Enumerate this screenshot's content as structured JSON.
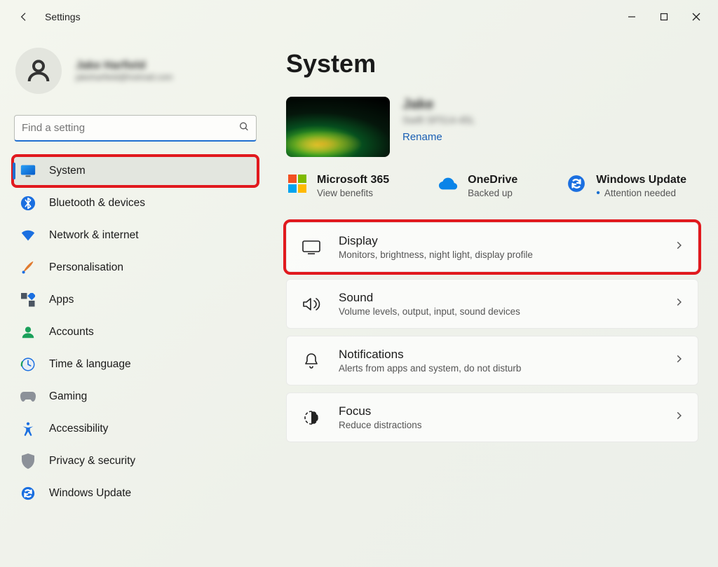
{
  "app_title": "Settings",
  "profile": {
    "name": "Jake Harfield",
    "email": "jakeharfield@hotmail.com"
  },
  "search": {
    "placeholder": "Find a setting"
  },
  "sidebar": {
    "items": [
      {
        "label": "System",
        "active": true
      },
      {
        "label": "Bluetooth & devices"
      },
      {
        "label": "Network & internet"
      },
      {
        "label": "Personalisation"
      },
      {
        "label": "Apps"
      },
      {
        "label": "Accounts"
      },
      {
        "label": "Time & language"
      },
      {
        "label": "Gaming"
      },
      {
        "label": "Accessibility"
      },
      {
        "label": "Privacy & security"
      },
      {
        "label": "Windows Update"
      }
    ]
  },
  "main": {
    "heading": "System",
    "device": {
      "name": "Jake",
      "model": "Swift SF514-45L",
      "rename": "Rename"
    },
    "status": {
      "m365": {
        "title": "Microsoft 365",
        "sub": "View benefits"
      },
      "onedrive": {
        "title": "OneDrive",
        "sub": "Backed up"
      },
      "update": {
        "title": "Windows Update",
        "sub": "Attention needed"
      }
    },
    "settings": [
      {
        "title": "Display",
        "sub": "Monitors, brightness, night light, display profile"
      },
      {
        "title": "Sound",
        "sub": "Volume levels, output, input, sound devices"
      },
      {
        "title": "Notifications",
        "sub": "Alerts from apps and system, do not disturb"
      },
      {
        "title": "Focus",
        "sub": "Reduce distractions"
      }
    ]
  }
}
